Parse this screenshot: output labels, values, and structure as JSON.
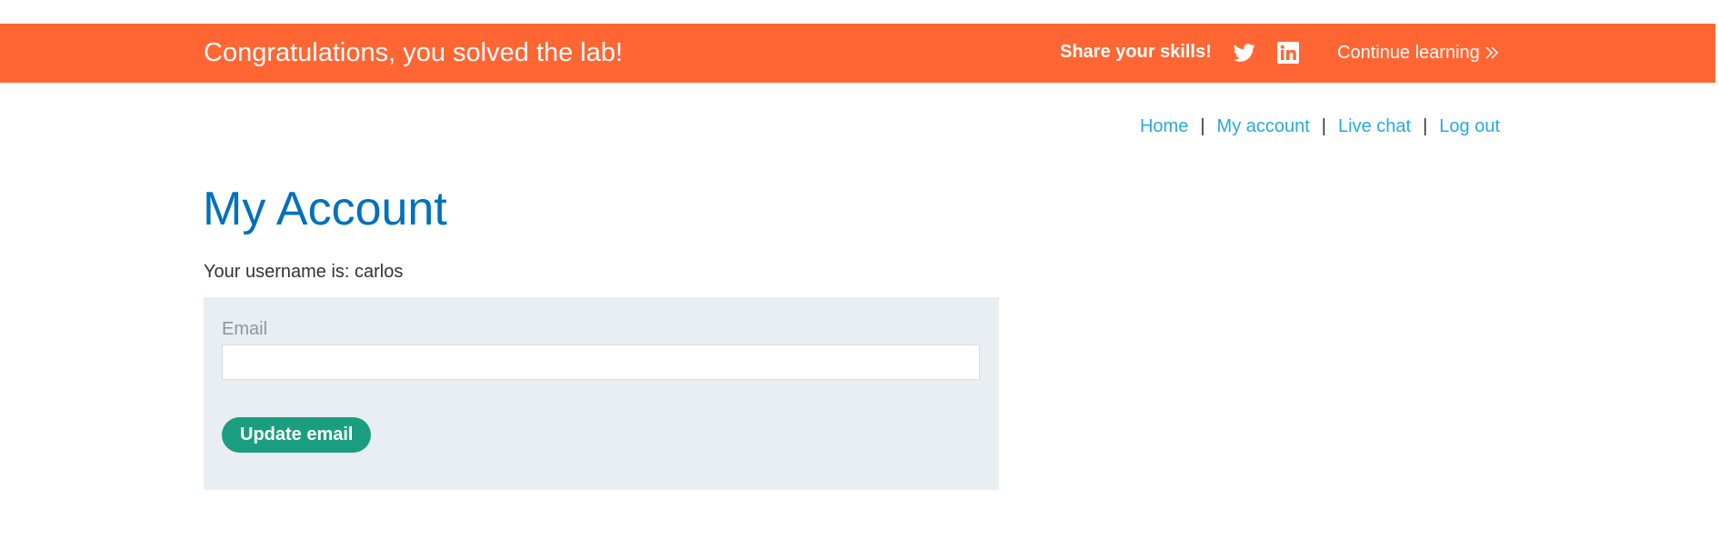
{
  "banner": {
    "title": "Congratulations, you solved the lab!",
    "share_label": "Share your skills!",
    "twitter_icon": "twitter-icon",
    "linkedin_icon": "linkedin-icon",
    "continue_label": "Continue learning",
    "continue_icon": "double-chevron-right-icon",
    "background_color": "#ff6633"
  },
  "nav": {
    "items": [
      {
        "label": "Home"
      },
      {
        "label": "My account"
      },
      {
        "label": "Live chat"
      },
      {
        "label": "Log out"
      }
    ],
    "separator": "|",
    "link_color": "#29a8e0"
  },
  "main": {
    "title": "My Account",
    "username_text": "Your username is: carlos",
    "form": {
      "email_label": "Email",
      "email_value": "",
      "button_label": "Update email",
      "button_color": "#1a9e7f",
      "panel_color": "#e8eef1"
    },
    "title_color": "#0071bc"
  }
}
